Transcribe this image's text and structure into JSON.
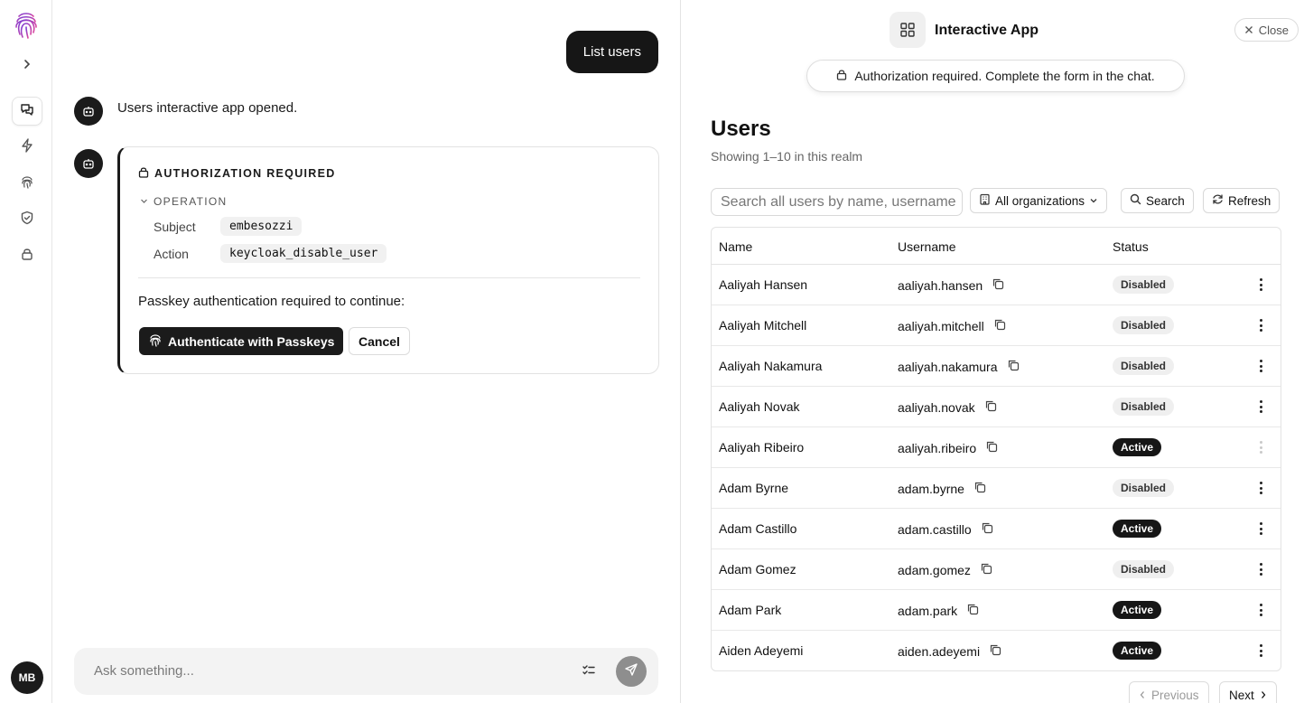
{
  "rail": {
    "icons": [
      "fingerprint-logo-icon",
      "chevron-right-icon",
      "chat-icon",
      "bolt-icon",
      "fingerprint-icon",
      "shield-check-icon",
      "lock-icon"
    ],
    "avatar_initials": "MB"
  },
  "chat": {
    "user_message": "List users",
    "bot_message": "Users interactive app opened.",
    "auth_card": {
      "title": "AUTHORIZATION REQUIRED",
      "operation_label": "OPERATION",
      "subject_label": "Subject",
      "subject_value": "embesozzi",
      "action_label": "Action",
      "action_value": "keycloak_disable_user",
      "passkey_text": "Passkey authentication required to continue:",
      "authenticate_label": "Authenticate with Passkeys",
      "cancel_label": "Cancel"
    },
    "composer": {
      "placeholder": "Ask something..."
    }
  },
  "app": {
    "title": "Interactive App",
    "close_label": "Close",
    "banner": "Authorization required. Complete the form in the chat.",
    "users_title": "Users",
    "users_subtitle": "Showing 1–10 in this realm",
    "search_placeholder": "Search all users by name, username",
    "org_filter": "All organizations",
    "search_label": "Search",
    "refresh_label": "Refresh",
    "columns": [
      "Name",
      "Username",
      "Status"
    ],
    "rows": [
      {
        "name": "Aaliyah Hansen",
        "username": "aaliyah.hansen",
        "status": "Disabled"
      },
      {
        "name": "Aaliyah Mitchell",
        "username": "aaliyah.mitchell",
        "status": "Disabled"
      },
      {
        "name": "Aaliyah Nakamura",
        "username": "aaliyah.nakamura",
        "status": "Disabled"
      },
      {
        "name": "Aaliyah Novak",
        "username": "aaliyah.novak",
        "status": "Disabled"
      },
      {
        "name": "Aaliyah Ribeiro",
        "username": "aaliyah.ribeiro",
        "status": "Active"
      },
      {
        "name": "Adam Byrne",
        "username": "adam.byrne",
        "status": "Disabled"
      },
      {
        "name": "Adam Castillo",
        "username": "adam.castillo",
        "status": "Active"
      },
      {
        "name": "Adam Gomez",
        "username": "adam.gomez",
        "status": "Disabled"
      },
      {
        "name": "Adam Park",
        "username": "adam.park",
        "status": "Active"
      },
      {
        "name": "Aiden Adeyemi",
        "username": "aiden.adeyemi",
        "status": "Active"
      }
    ],
    "previous_label": "Previous",
    "next_label": "Next"
  },
  "colors": {
    "primary_dark": "#161616",
    "badge_disabled_bg": "#efefef",
    "logo_gradient_start": "#7a3fd6",
    "logo_gradient_end": "#e0459b"
  }
}
